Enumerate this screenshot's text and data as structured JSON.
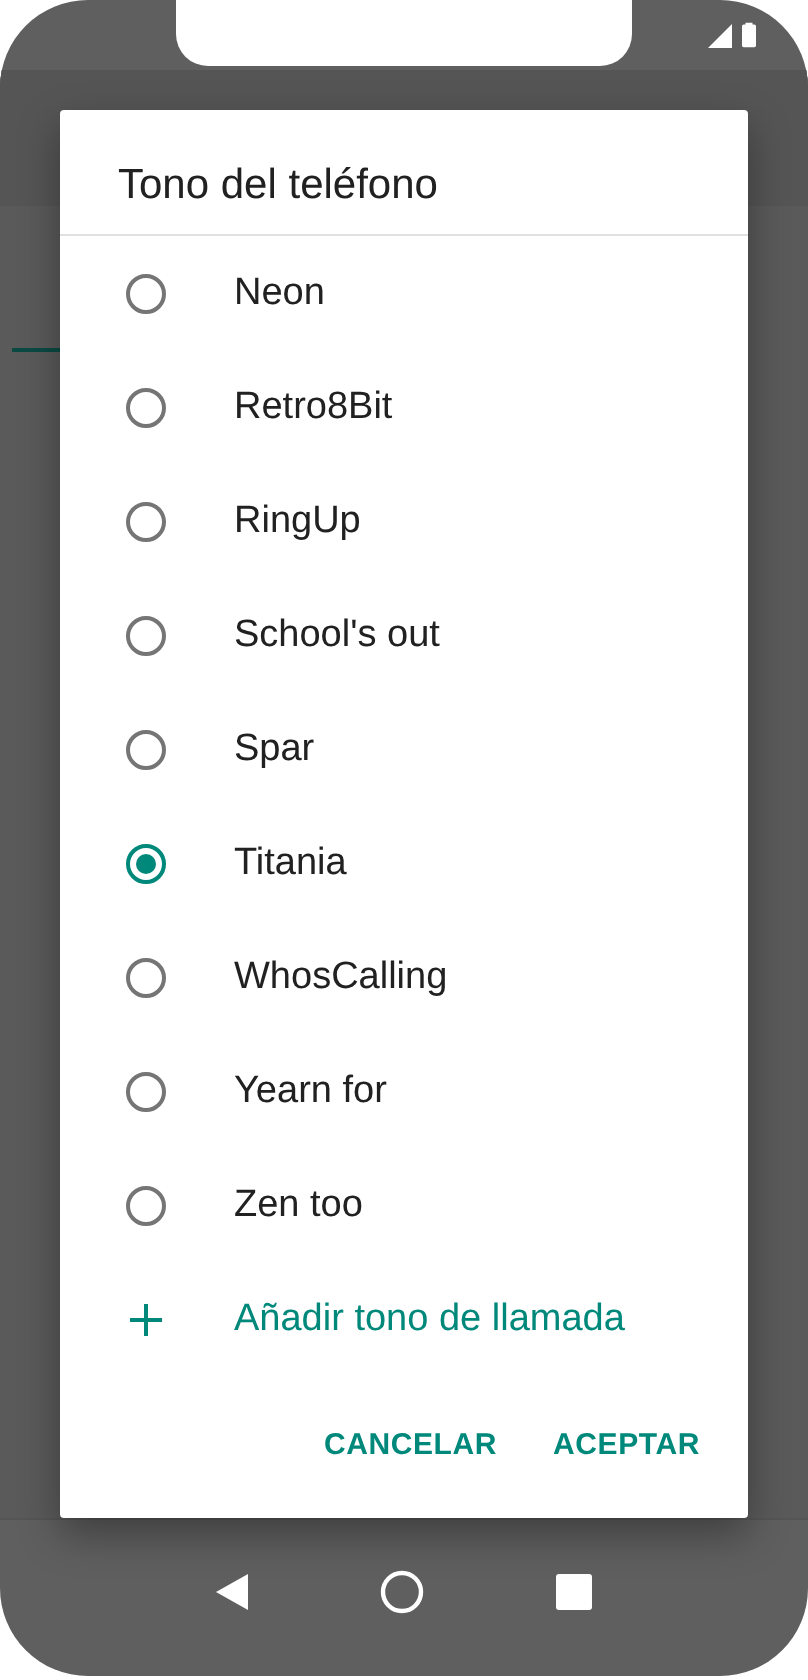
{
  "dialog": {
    "title": "Tono del teléfono",
    "options": [
      {
        "label": "Neon",
        "selected": false
      },
      {
        "label": "Retro8Bit",
        "selected": false
      },
      {
        "label": "RingUp",
        "selected": false
      },
      {
        "label": "School's out",
        "selected": false
      },
      {
        "label": "Spar",
        "selected": false
      },
      {
        "label": "Titania",
        "selected": true
      },
      {
        "label": "WhosCalling",
        "selected": false
      },
      {
        "label": "Yearn for",
        "selected": false
      },
      {
        "label": "Zen too",
        "selected": false
      }
    ],
    "add_action": {
      "label": "Añadir tono de llamada"
    },
    "buttons": [
      "CANCELAR",
      "ACEPTAR"
    ]
  }
}
